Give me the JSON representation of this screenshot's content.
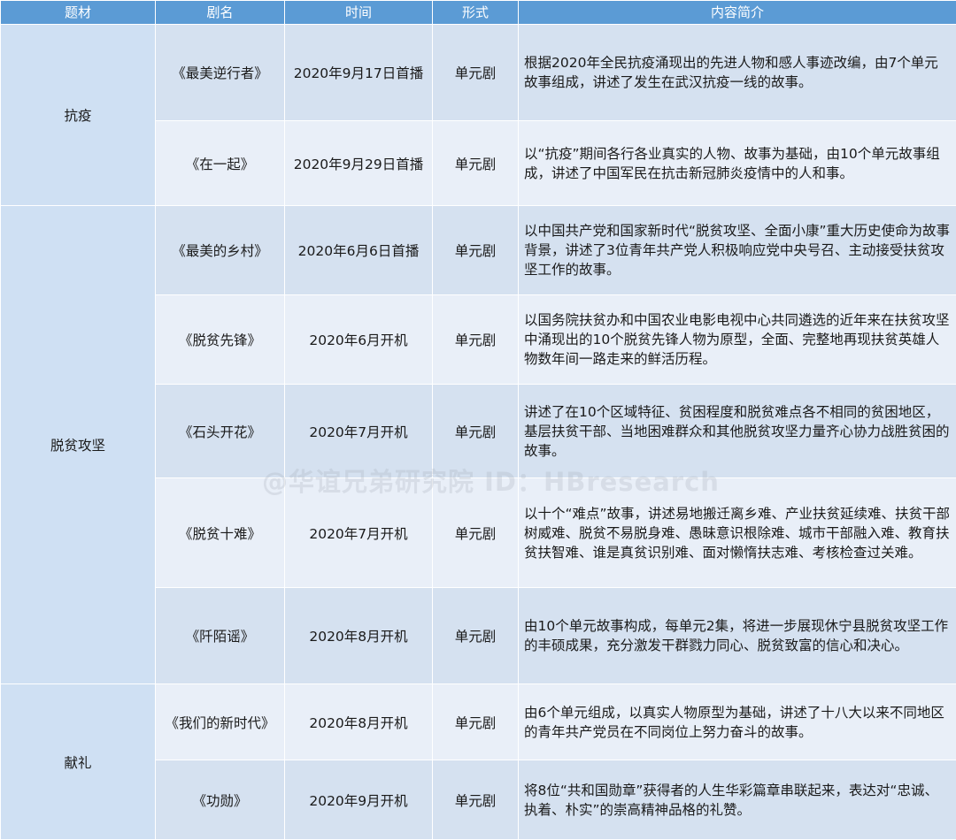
{
  "headers": {
    "topic": "题材",
    "title": "剧名",
    "time": "时间",
    "form": "形式",
    "desc": "内容简介"
  },
  "groups": [
    {
      "topic": "抗疫",
      "rows": [
        {
          "title": "《最美逆行者》",
          "time": "2020年9月17日首播",
          "form": "单元剧",
          "desc": "根据2020年全民抗疫涌现出的先进人物和感人事迹改编，由7个单元故事组成，讲述了发生在武汉抗疫一线的故事。"
        },
        {
          "title": "《在一起》",
          "time": "2020年9月29日首播",
          "form": "单元剧",
          "desc": "以“抗疫”期间各行各业真实的人物、故事为基础，由10个单元故事组成，讲述了中国军民在抗击新冠肺炎疫情中的人和事。"
        }
      ]
    },
    {
      "topic": "脱贫攻坚",
      "rows": [
        {
          "title": "《最美的乡村》",
          "time": "2020年6月6日首播",
          "form": "单元剧",
          "desc": "以中国共产党和国家新时代“脱贫攻坚、全面小康”重大历史使命为故事背景，讲述了3位青年共产党人积极响应党中央号召、主动接受扶贫攻坚工作的故事。"
        },
        {
          "title": "《脱贫先锋》",
          "time": "2020年6月开机",
          "form": "单元剧",
          "desc": "以国务院扶贫办和中国农业电影电视中心共同遴选的近年来在扶贫攻坚中涌现出的10个脱贫先锋人物为原型，全面、完整地再现扶贫英雄人物数年间一路走来的鲜活历程。"
        },
        {
          "title": "《石头开花》",
          "time": "2020年7月开机",
          "form": "单元剧",
          "desc": "讲述了在10个区域特征、贫困程度和脱贫难点各不相同的贫困地区，基层扶贫干部、当地困难群众和其他脱贫攻坚力量齐心协力战胜贫困的故事。"
        },
        {
          "title": "《脱贫十难》",
          "time": "2020年7月开机",
          "form": "单元剧",
          "desc": "以十个“难点”故事，讲述易地搬迁离乡难、产业扶贫延续难、扶贫干部树威难、脱贫不易脱身难、愚昧意识根除难、城市干部融入难、教育扶贫扶智难、谁是真贫识别难、面对懒惰扶志难、考核检查过关难。"
        },
        {
          "title": "《阡陌谣》",
          "time": "2020年8月开机",
          "form": "单元剧",
          "desc": "由10个单元故事构成，每单元2集，将进一步展现休宁县脱贫攻坚工作的丰硕成果，充分激发干群戮力同心、脱贫致富的信心和决心。"
        }
      ]
    },
    {
      "topic": "献礼",
      "rows": [
        {
          "title": "《我们的新时代》",
          "time": "2020年8月开机",
          "form": "单元剧",
          "desc": "由6个单元组成，以真实人物原型为基础，讲述了十八大以来不同地区的青年共产党员在不同岗位上努力奋斗的故事。"
        },
        {
          "title": "《功勋》",
          "time": "2020年9月开机",
          "form": "单元剧",
          "desc": "将8位“共和国勋章”获得者的人生华彩篇章串联起来，表达对“忠诚、执着、朴实”的崇高精神品格的礼赞。"
        }
      ]
    }
  ],
  "watermark": "@华谊兄弟研究院 ID：HBresearch",
  "colors": {
    "header": "#5b9bd5",
    "topic_cell": "#cfe0f3",
    "row_odd": "#d5e1f0",
    "row_even": "#e9eff8"
  }
}
